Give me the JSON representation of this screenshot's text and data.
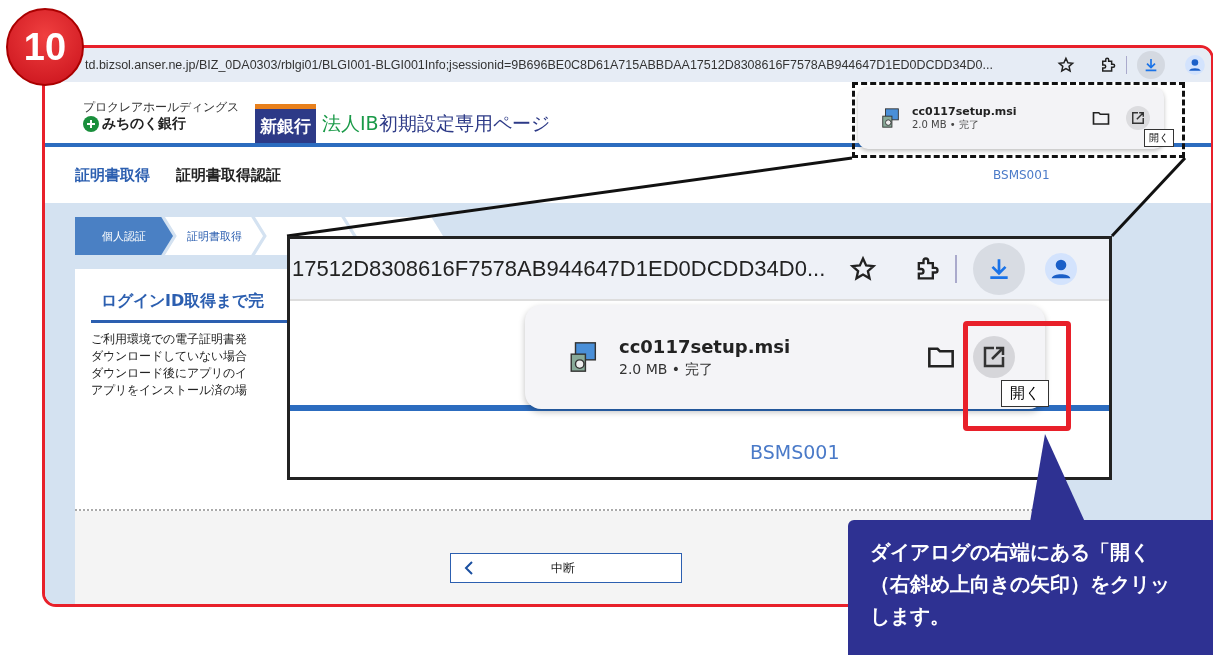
{
  "step_badge": "10",
  "browser": {
    "url": "td.bizsol.anser.ne.jp/BIZ_0DA0303/rblgi01/BLGI001-BLGI001Info;jsessionid=9B696BE0C8D61A715ABBDAA17512D8308616F7578AB944647D1ED0DCDD34D0..."
  },
  "download_popup": {
    "file_name": "cc0117setup.msi",
    "details": "2.0 MB • 完了",
    "tooltip": "開く"
  },
  "header": {
    "group_name": "プロクレアホールディングス",
    "bank_name": "みちのく銀行",
    "badge": "新銀行",
    "title_prefix": "法人IB",
    "title": "初期設定専用ページ"
  },
  "nav": {
    "items": [
      {
        "label": "証明書取得",
        "selected": true
      },
      {
        "label": "証明書取得認証",
        "selected": false
      }
    ],
    "screen_id": "BSMS001"
  },
  "steps": [
    {
      "label": "個人認証",
      "selected": true
    },
    {
      "label": "証明書取得",
      "selected": false
    }
  ],
  "card": {
    "heading": "ログインID取得まで完",
    "lines": [
      "ご利用環境での電子証明書発",
      "ダウンロードしていない場合",
      "ダウンロード後にアプリのイ",
      "アプリをインストール済の場"
    ]
  },
  "cancel_button": "中断",
  "inset": {
    "url_fragment": "17512D8308616F7578AB944647D1ED0DCDD34D0...",
    "file_name": "cc0117setup.msi",
    "details": "2.0 MB • 完了",
    "tooltip": "開く",
    "screen_id": "BSMS001"
  },
  "callout": {
    "lines": [
      "ダイアログの右端にある「開く",
      "（右斜め上向きの矢印）をクリッ",
      "します。"
    ]
  }
}
